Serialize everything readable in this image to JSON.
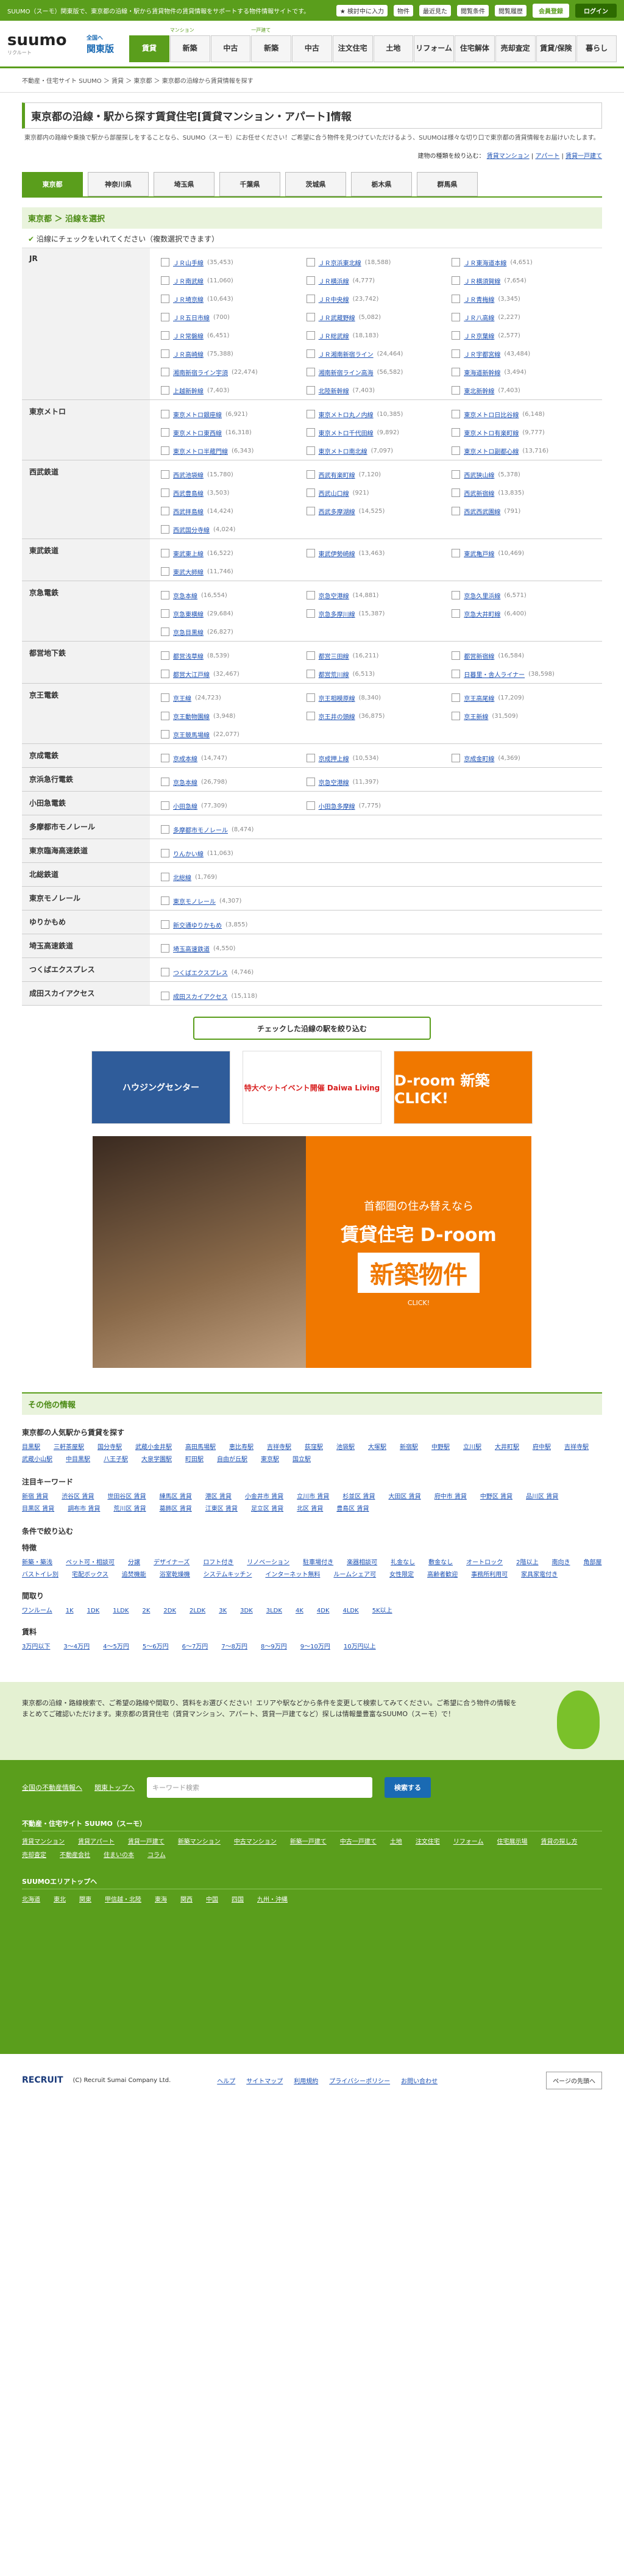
{
  "topbar": {
    "tagline": "SUUMO（スーモ）関東版で、東京都の沿線・駅から賃貸物件の賃貸情報をサポートする物件情報サイトです。",
    "fav": "★ 検討中に入力",
    "items": [
      "物件",
      "最近見た",
      "閲覧条件"
    ],
    "help": "閲覧履歴",
    "register": "会員登録",
    "login": "ログイン"
  },
  "header": {
    "logo": "suumo",
    "logo_sub": "リクルート",
    "region": "全国へ",
    "region2": "関東版",
    "nav": [
      {
        "cap": "",
        "label": "賃貸"
      },
      {
        "cap": "マンション",
        "label": "新築"
      },
      {
        "cap": "",
        "label": "中古"
      },
      {
        "cap": "一戸建て",
        "label": "新築"
      },
      {
        "cap": "",
        "label": "中古"
      },
      {
        "cap": "",
        "label": "注文住宅"
      },
      {
        "cap": "",
        "label": "土地"
      },
      {
        "cap": "",
        "label": "リフォーム"
      },
      {
        "cap": "",
        "label": "住宅解体"
      },
      {
        "cap": "",
        "label": "売却査定"
      },
      {
        "cap": "",
        "label": "賃貸/保険"
      },
      {
        "cap": "",
        "label": "暮らし"
      }
    ]
  },
  "breadcrumb": "不動産・住宅サイト SUUMO ＞ 賃貸 ＞ 東京都 ＞ 東京都の沿線から賃貸情報を探す",
  "title": "東京都の沿線・駅から探す賃貸住宅[賃貸マンション・アパート]情報",
  "lead": "東京都内の路線や乗換で駅から部屋探しをすることなら、SUUMO（スーモ）にお任せください！ご希望に合う物件を見つけていただけるよう、SUUMOは様々な切り口で東京都の賃貸情報をお届けいたします。",
  "filter": {
    "label": "建物の種類を絞り込む",
    "opts": [
      "賃貸マンション",
      "アパート",
      "賃貸一戸建て"
    ]
  },
  "pref_tabs": [
    "東京都",
    "神奈川県",
    "埼玉県",
    "千葉県",
    "茨城県",
    "栃木県",
    "群馬県"
  ],
  "section_title": "東京都 ＞ 沿線を選択",
  "check_note": "沿線にチェックをいれてください（複数選択できます）",
  "rails": [
    {
      "company": "JR",
      "lines": [
        [
          "ＪＲ山手線",
          "(35,453)"
        ],
        [
          "ＪＲ京浜東北線",
          "(18,588)"
        ],
        [
          "ＪＲ東海道本線",
          "(4,651)"
        ],
        [
          "ＪＲ南武線",
          "(11,060)"
        ],
        [
          "ＪＲ横浜線",
          "(4,777)"
        ],
        [
          "ＪＲ横須賀線",
          "(7,654)"
        ],
        [
          "ＪＲ埼京線",
          "(10,643)"
        ],
        [
          "ＪＲ中央線",
          "(23,742)"
        ],
        [
          "ＪＲ青梅線",
          "(3,345)"
        ],
        [
          "ＪＲ五日市線",
          "(700)"
        ],
        [
          "ＪＲ武蔵野線",
          "(5,082)"
        ],
        [
          "ＪＲ八高線",
          "(2,227)"
        ],
        [
          "ＪＲ常磐線",
          "(6,451)"
        ],
        [
          "ＪＲ総武線",
          "(18,183)"
        ],
        [
          "ＪＲ京葉線",
          "(2,577)"
        ],
        [
          "ＪＲ高崎線",
          "(75,388)"
        ],
        [
          "ＪＲ湘南新宿ライン",
          "(24,464)"
        ],
        [
          "ＪＲ宇都宮線",
          "(43,484)"
        ],
        [
          "湘南新宿ライン宇須",
          "(22,474)"
        ],
        [
          "湘南新宿ライン高海",
          "(56,582)"
        ],
        [
          "東海道新幹線",
          "(3,494)"
        ],
        [
          "上越新幹線",
          "(7,403)"
        ],
        [
          "北陸新幹線",
          "(7,403)"
        ],
        [
          "東北新幹線",
          "(7,403)"
        ]
      ]
    },
    {
      "company": "東京メトロ",
      "lines": [
        [
          "東京メトロ銀座線",
          "(6,921)"
        ],
        [
          "東京メトロ丸ノ内線",
          "(10,385)"
        ],
        [
          "東京メトロ日比谷線",
          "(6,148)"
        ],
        [
          "東京メトロ東西線",
          "(16,318)"
        ],
        [
          "東京メトロ千代田線",
          "(9,892)"
        ],
        [
          "東京メトロ有楽町線",
          "(9,777)"
        ],
        [
          "東京メトロ半蔵門線",
          "(6,343)"
        ],
        [
          "東京メトロ南北線",
          "(7,097)"
        ],
        [
          "東京メトロ副都心線",
          "(13,716)"
        ]
      ]
    },
    {
      "company": "西武鉄道",
      "lines": [
        [
          "西武池袋線",
          "(15,780)"
        ],
        [
          "西武有楽町線",
          "(7,120)"
        ],
        [
          "西武狭山線",
          "(5,378)"
        ],
        [
          "西武豊島線",
          "(3,503)"
        ],
        [
          "西武山口線",
          "(921)"
        ],
        [
          "西武新宿線",
          "(13,835)"
        ],
        [
          "西武拝島線",
          "(14,424)"
        ],
        [
          "西武多摩湖線",
          "(14,525)"
        ],
        [
          "西武西武園線",
          "(791)"
        ],
        [
          "西武国分寺線",
          "(4,024)"
        ]
      ]
    },
    {
      "company": "東武鉄道",
      "lines": [
        [
          "東武東上線",
          "(16,522)"
        ],
        [
          "東武伊勢崎線",
          "(13,463)"
        ],
        [
          "東武亀戸線",
          "(10,469)"
        ],
        [
          "東武大師線",
          "(11,746)"
        ]
      ]
    },
    {
      "company": "京急電鉄",
      "lines": [
        [
          "京急本線",
          "(16,554)"
        ],
        [
          "京急空港線",
          "(14,881)"
        ],
        [
          "京急久里浜線",
          "(6,571)"
        ],
        [
          "京急東横線",
          "(29,684)"
        ],
        [
          "京急多摩川線",
          "(15,387)"
        ],
        [
          "京急大井町線",
          "(6,400)"
        ],
        [
          "京急目黒線",
          "(26,827)"
        ]
      ]
    },
    {
      "company": "都営地下鉄",
      "lines": [
        [
          "都営浅草線",
          "(8,539)"
        ],
        [
          "都営三田線",
          "(16,211)"
        ],
        [
          "都営新宿線",
          "(16,584)"
        ],
        [
          "都営大江戸線",
          "(32,467)"
        ],
        [
          "都営荒川線",
          "(6,513)"
        ],
        [
          "日暮里・舎人ライナー",
          "(38,598)"
        ]
      ]
    },
    {
      "company": "京王電鉄",
      "lines": [
        [
          "京王線",
          "(24,723)"
        ],
        [
          "京王相模原線",
          "(8,340)"
        ],
        [
          "京王高尾線",
          "(17,209)"
        ],
        [
          "京王動物園線",
          "(3,948)"
        ],
        [
          "京王井の頭線",
          "(36,875)"
        ],
        [
          "京王新線",
          "(31,509)"
        ],
        [
          "京王競馬場線",
          "(22,077)"
        ]
      ]
    },
    {
      "company": "京成電鉄",
      "lines": [
        [
          "京成本線",
          "(14,747)"
        ],
        [
          "京成押上線",
          "(10,534)"
        ],
        [
          "京成金町線",
          "(4,369)"
        ]
      ]
    },
    {
      "company": "京浜急行電鉄",
      "lines": [
        [
          "京急本線",
          "(26,798)"
        ],
        [
          "京急空港線",
          "(11,397)"
        ]
      ]
    },
    {
      "company": "小田急電鉄",
      "lines": [
        [
          "小田急線",
          "(77,309)"
        ],
        [
          "小田急多摩線",
          "(7,775)"
        ]
      ]
    },
    {
      "company": "多摩都市モノレール",
      "lines": [
        [
          "多摩都市モノレール",
          "(8,474)"
        ]
      ]
    },
    {
      "company": "東京臨海高速鉄道",
      "lines": [
        [
          "りんかい線",
          "(11,063)"
        ]
      ]
    },
    {
      "company": "北総鉄道",
      "lines": [
        [
          "北総線",
          "(1,769)"
        ]
      ]
    },
    {
      "company": "東京モノレール",
      "lines": [
        [
          "東京モノレール",
          "(4,307)"
        ]
      ]
    },
    {
      "company": "ゆりかもめ",
      "lines": [
        [
          "新交通ゆりかもめ",
          "(3,855)"
        ]
      ]
    },
    {
      "company": "埼玉高速鉄道",
      "lines": [
        [
          "埼玉高速鉄道",
          "(4,550)"
        ]
      ]
    },
    {
      "company": "つくばエクスプレス",
      "lines": [
        [
          "つくばエクスプレス",
          "(4,746)"
        ]
      ]
    },
    {
      "company": "成田スカイアクセス",
      "lines": [
        [
          "成田スカイアクセス",
          "(15,118)"
        ]
      ]
    }
  ],
  "submit": "チェックした沿線の駅を絞り込む",
  "ads": [
    "ハウジングセンター",
    "特大ペットイベント開催 Daiwa Living",
    "D-room 新築 CLICK!"
  ],
  "bigad": {
    "t1": "首都圏の住み替えなら",
    "t2": "賃貸住宅 D-room",
    "t3": "新築物件",
    "t4": "CLICK!"
  },
  "other_title": "その他の情報",
  "popular": {
    "title": "東京都の人気駅から賃貸を探す",
    "links": [
      "目黒駅",
      "三軒茶屋駅",
      "国分寺駅",
      "武蔵小金井駅",
      "高田馬場駅",
      "恵比寿駅",
      "吉祥寺駅",
      "荻窪駅",
      "池袋駅",
      "大塚駅",
      "新宿駅",
      "中野駅",
      "立川駅",
      "大井町駅",
      "府中駅",
      "吉祥寺駅",
      "武蔵小山駅",
      "中目黒駅",
      "八王子駅",
      "大泉学園駅",
      "町田駅",
      "自由が丘駅",
      "東京駅",
      "国立駅"
    ]
  },
  "keywords": {
    "title": "注目キーワード",
    "links": [
      "新宿 賃貸",
      "渋谷区 賃貸",
      "世田谷区 賃貸",
      "練馬区 賃貸",
      "港区 賃貸",
      "小金井市 賃貸",
      "立川市 賃貸",
      "杉並区 賃貸",
      "大田区 賃貸",
      "府中市 賃貸",
      "中野区 賃貸",
      "品川区 賃貸",
      "目黒区 賃貸",
      "調布市 賃貸",
      "荒川区 賃貸",
      "葛飾区 賃貸",
      "江東区 賃貸",
      "足立区 賃貸",
      "北区 賃貸",
      "豊島区 賃貸"
    ]
  },
  "conditions": {
    "title": "条件で絞り込む",
    "feature": "特徴",
    "features": [
      "新築・築浅",
      "ペット可・相談可",
      "分譲",
      "デザイナーズ",
      "ロフト付き",
      "リノベーション",
      "駐車場付き",
      "楽器相談可",
      "礼金なし",
      "敷金なし",
      "オートロック",
      "2階以上",
      "南向き",
      "角部屋",
      "バストイレ別",
      "宅配ボックス",
      "追焚機能",
      "浴室乾燥機",
      "システムキッチン",
      "インターネット無料",
      "ルームシェア可",
      "女性限定",
      "高齢者歓迎",
      "事務所利用可",
      "家具家電付き"
    ],
    "layout": "間取り",
    "layouts": [
      "ワンルーム",
      "1K",
      "1DK",
      "1LDK",
      "2K",
      "2DK",
      "2LDK",
      "3K",
      "3DK",
      "3LDK",
      "4K",
      "4DK",
      "4LDK",
      "5K以上"
    ],
    "rent": "賃料",
    "rents": [
      "3万円以下",
      "3～4万円",
      "4～5万円",
      "5～6万円",
      "6～7万円",
      "7～8万円",
      "8～9万円",
      "9～10万円",
      "10万円以上"
    ]
  },
  "foot_band": "東京都の沿線・路線検索で、ご希望の路線や間取り、賃料をお選びください！エリアや駅などから条件を変更して検索してみてください。ご希望に合う物件の情報をまとめてご確認いただけます。東京都の賃貸住宅（賃貸マンション、アパート、賃貸一戸建てなど）探しは情報量豊富なSUUMO（スーモ）で！",
  "gfoot": {
    "links1": [
      "全国の不動産情報へ",
      "関東トップへ"
    ],
    "placeholder": "キーワード検索",
    "search": "検索する",
    "head1": "不動産・住宅サイト SUUMO（スーモ）",
    "links2": [
      "賃貸マンション",
      "賃貸アパート",
      "賃貸一戸建て",
      "新築マンション",
      "中古マンション",
      "新築一戸建て",
      "中古一戸建て",
      "土地",
      "注文住宅",
      "リフォーム",
      "住宅展示場",
      "賃貸の探し方",
      "売却査定",
      "不動産会社",
      "住まいの本",
      "コラム"
    ],
    "head2": "SUUMOエリアトップへ",
    "areas": [
      "北海道",
      "東北",
      "関東",
      "甲信越・北陸",
      "東海",
      "関西",
      "中国",
      "四国",
      "九州・沖縄"
    ]
  },
  "bottom": {
    "brand": "RECRUIT",
    "copy": "(C) Recruit Sumai Company Ltd.",
    "links": [
      "ヘルプ",
      "サイトマップ",
      "利用規約",
      "プライバシーポリシー",
      "お問い合わせ"
    ],
    "pagetop": "ページの先頭へ"
  }
}
